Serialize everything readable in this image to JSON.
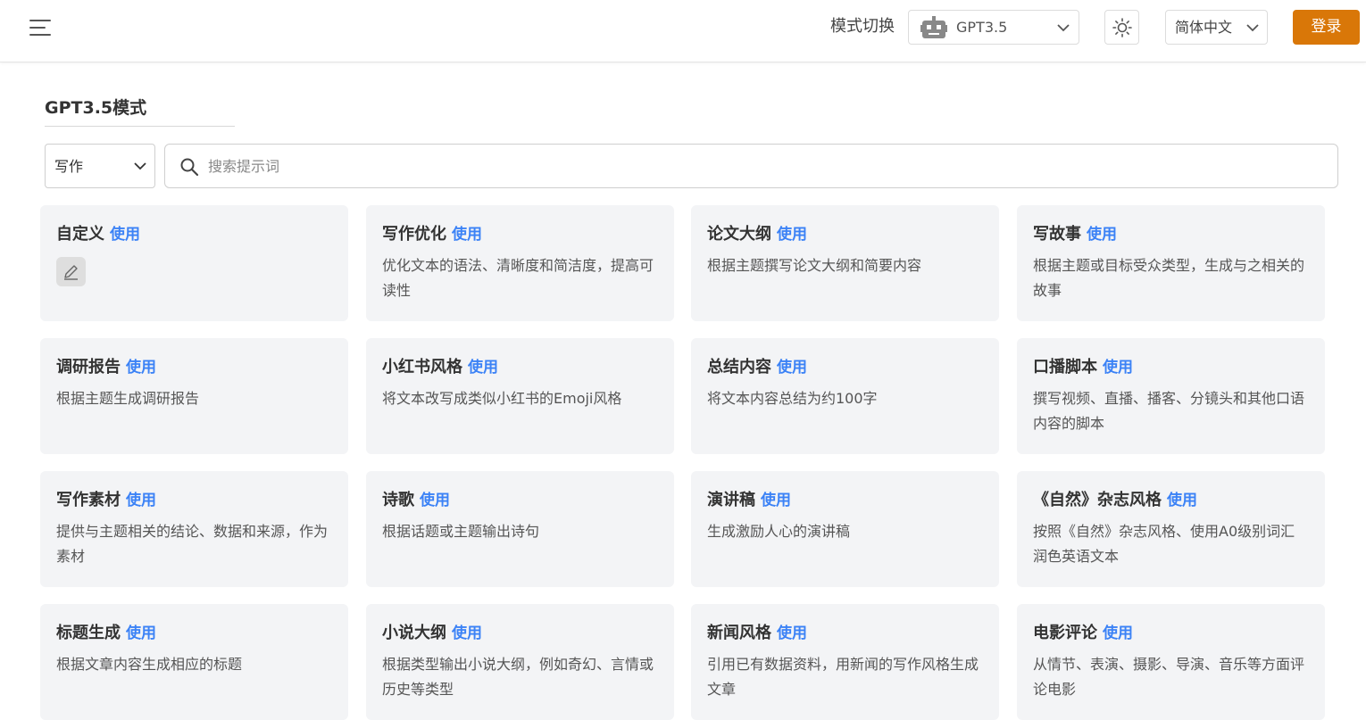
{
  "header": {
    "mode_label": "模式切换",
    "model_value": "GPT3.5",
    "language_value": "简体中文",
    "login_label": "登录"
  },
  "section": {
    "title": "GPT3.5模式"
  },
  "filter": {
    "category_value": "写作",
    "search_placeholder": "搜索提示词"
  },
  "use_label": "使用",
  "cards": [
    {
      "title": "自定义",
      "desc": "",
      "icon": "edit-icon"
    },
    {
      "title": "写作优化",
      "desc": "优化文本的语法、清晰度和简洁度，提高可读性"
    },
    {
      "title": "论文大纲",
      "desc": "根据主题撰写论文大纲和简要内容"
    },
    {
      "title": "写故事",
      "desc": "根据主题或目标受众类型，生成与之相关的故事"
    },
    {
      "title": "调研报告",
      "desc": "根据主题生成调研报告"
    },
    {
      "title": "小红书风格",
      "desc": "将文本改写成类似小红书的Emoji风格"
    },
    {
      "title": "总结内容",
      "desc": "将文本内容总结为约100字"
    },
    {
      "title": "口播脚本",
      "desc": "撰写视频、直播、播客、分镜头和其他口语内容的脚本"
    },
    {
      "title": "写作素材",
      "desc": "提供与主题相关的结论、数据和来源，作为素材"
    },
    {
      "title": "诗歌",
      "desc": "根据话题或主题输出诗句"
    },
    {
      "title": "演讲稿",
      "desc": "生成激励人心的演讲稿"
    },
    {
      "title": "《自然》杂志风格",
      "desc": "按照《自然》杂志风格、使用A0级别词汇润色英语文本"
    },
    {
      "title": "标题生成",
      "desc": "根据文章内容生成相应的标题"
    },
    {
      "title": "小说大纲",
      "desc": "根据类型输出小说大纲，例如奇幻、言情或历史等类型"
    },
    {
      "title": "新闻风格",
      "desc": "引用已有数据资料，用新闻的写作风格生成文章"
    },
    {
      "title": "电影评论",
      "desc": "从情节、表演、摄影、导演、音乐等方面评论电影"
    }
  ],
  "colors": {
    "accent": "#d97708",
    "link": "#3b82f6",
    "card_bg": "#f3f4f6"
  }
}
